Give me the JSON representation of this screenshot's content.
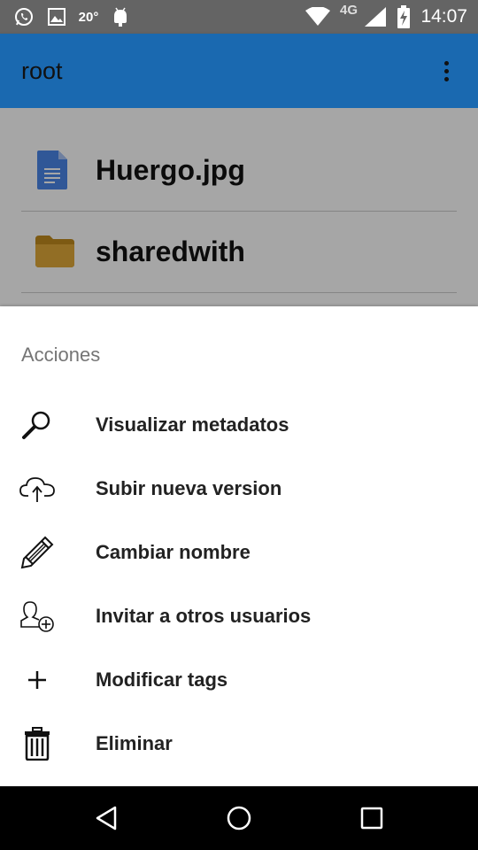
{
  "status_bar": {
    "temperature": "20°",
    "network": "4G",
    "time": "14:07"
  },
  "app_bar": {
    "title": "root"
  },
  "files": [
    {
      "name": "Huergo.jpg",
      "icon": "document-icon"
    },
    {
      "name": "sharedwith",
      "icon": "folder-icon"
    }
  ],
  "sheet": {
    "title": "Acciones",
    "actions": [
      {
        "label": "Visualizar metadatos",
        "icon": "magnifier-icon"
      },
      {
        "label": "Subir nueva version",
        "icon": "cloud-upload-icon"
      },
      {
        "label": "Cambiar nombre",
        "icon": "pencil-icon"
      },
      {
        "label": "Invitar a otros usuarios",
        "icon": "add-user-icon"
      },
      {
        "label": "Modificar tags",
        "icon": "plus-icon"
      },
      {
        "label": "Eliminar",
        "icon": "trash-icon"
      }
    ]
  },
  "colors": {
    "app_bar": "#1a69b0",
    "status_bar": "#646464",
    "nav_bar": "#000000"
  }
}
